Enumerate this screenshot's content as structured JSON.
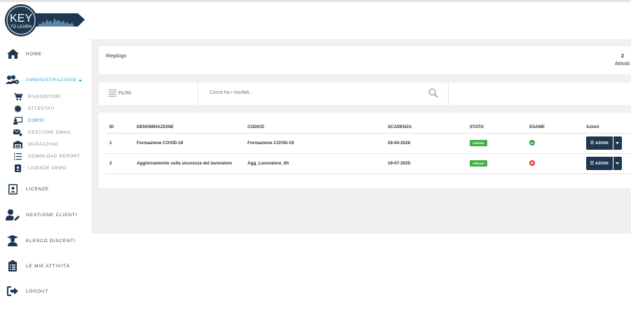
{
  "logo": {
    "line1": "KEY",
    "line2": "TO LEARN"
  },
  "sidebar": {
    "home": "HOME",
    "admin": "AMMINISTRAZIONE",
    "subitems": [
      {
        "label": "RIVENDITORI",
        "icon": "cart-icon"
      },
      {
        "label": "ATTESTATI",
        "icon": "badge-icon"
      },
      {
        "label": "CORSI",
        "icon": "chalkboard-teacher-icon"
      },
      {
        "label": "GESTIONE EMAIL",
        "icon": "mail-settings-icon"
      },
      {
        "label": "MAGAZZINO",
        "icon": "warehouse-icon"
      },
      {
        "label": "DOWNLOAD REPORT",
        "icon": "list-ol-icon"
      },
      {
        "label": "LICENZE DEMO",
        "icon": "id-badge-icon"
      }
    ],
    "licenze": "LICENZE",
    "gestione_clienti": "GESTIONE CLIENTI",
    "elenco_discenti": "ELENCO DISCENTI",
    "attivita": "LE MIE ATTIVITÀ",
    "logout": "LOGOUT"
  },
  "summary": {
    "title": "Riepilogo",
    "count": "2",
    "count_label": "Attivati"
  },
  "filters": {
    "label": "FILTRI",
    "search_placeholder": "Cerca fra i risultati..."
  },
  "table": {
    "headers": [
      "ID",
      "DENOMINAZIONE",
      "CODICE",
      "SCADENZA",
      "STATO",
      "ESAME",
      "Azioni"
    ],
    "rows": [
      {
        "id": "1",
        "name": "Formazione COVID-19",
        "code": "Formazione COVID-19",
        "expiry": "29-04-2026",
        "status": "Attivato",
        "exam": "passed"
      },
      {
        "id": "2",
        "name": "Aggiornamento sulla sicurezza del lavoratore",
        "code": "Agg_Lavoratore_6h",
        "expiry": "19-07-2025",
        "status": "Attivato",
        "exam": "failed"
      }
    ],
    "action_label": "AZIONI"
  },
  "colors": {
    "brand_navy": "#1f3750",
    "accent_cyan": "#2aa7c9",
    "active_link": "#2b6cd4",
    "status_green": "#3cb043",
    "exam_fail": "#e53935"
  }
}
